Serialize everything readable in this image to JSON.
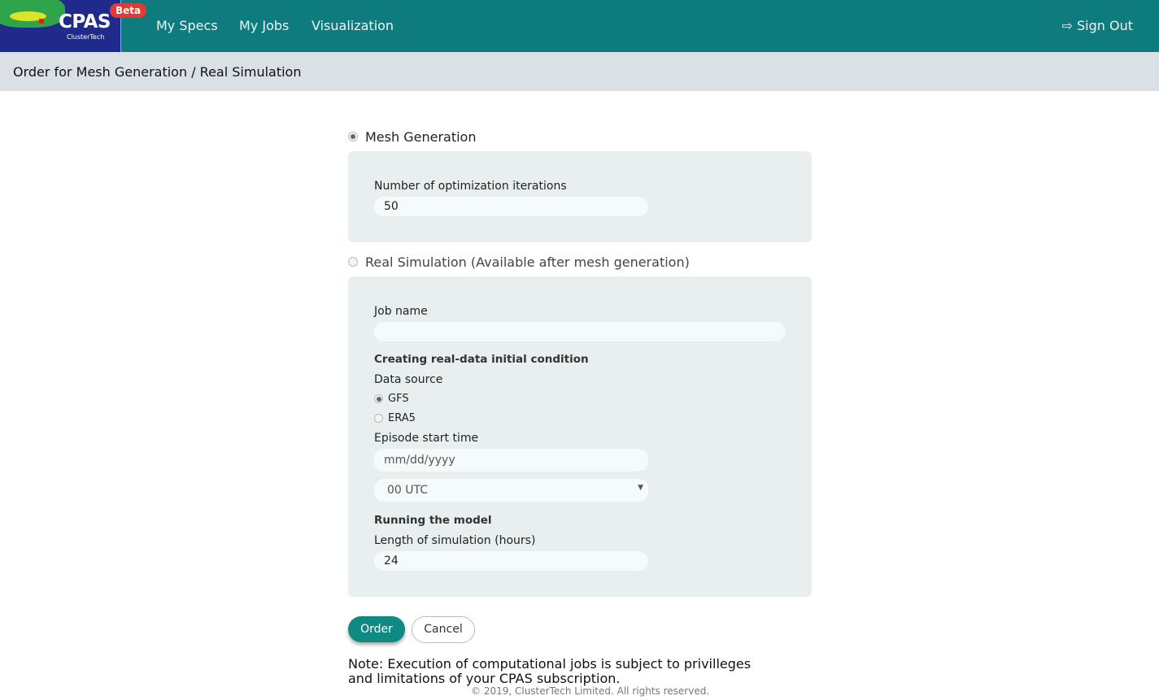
{
  "nav": {
    "logo_text": "CPAS",
    "logo_sub": "ClusterTech",
    "badge": "Beta",
    "links": [
      "My Specs",
      "My Jobs",
      "Visualization"
    ],
    "sign_out": "Sign Out",
    "color": "#0e7c7f"
  },
  "breadcrumb": "Order for Mesh Generation / Real Simulation",
  "mesh": {
    "label": "Mesh Generation",
    "selected": true,
    "iterations_label": "Number of optimization iterations",
    "iterations_value": "50"
  },
  "real": {
    "label": "Real Simulation (Available after mesh generation)",
    "selected": false,
    "job_name_label": "Job name",
    "job_name_value": "",
    "initial_heading": "Creating real-data initial condition",
    "data_source_label": "Data source",
    "sources": [
      {
        "label": "GFS",
        "selected": true
      },
      {
        "label": "ERA5",
        "selected": false
      }
    ],
    "start_label": "Episode start time",
    "date_placeholder": "mm/dd/yyyy",
    "hour_value": "00 UTC",
    "running_heading": "Running the model",
    "length_label": "Length of simulation (hours)",
    "length_value": "24"
  },
  "actions": {
    "order": "Order",
    "cancel": "Cancel"
  },
  "note": "Note: Execution of computational jobs is subject to privilleges and limitations of your CPAS subscription.",
  "footer": "© 2019, ClusterTech Limited. All rights reserved."
}
